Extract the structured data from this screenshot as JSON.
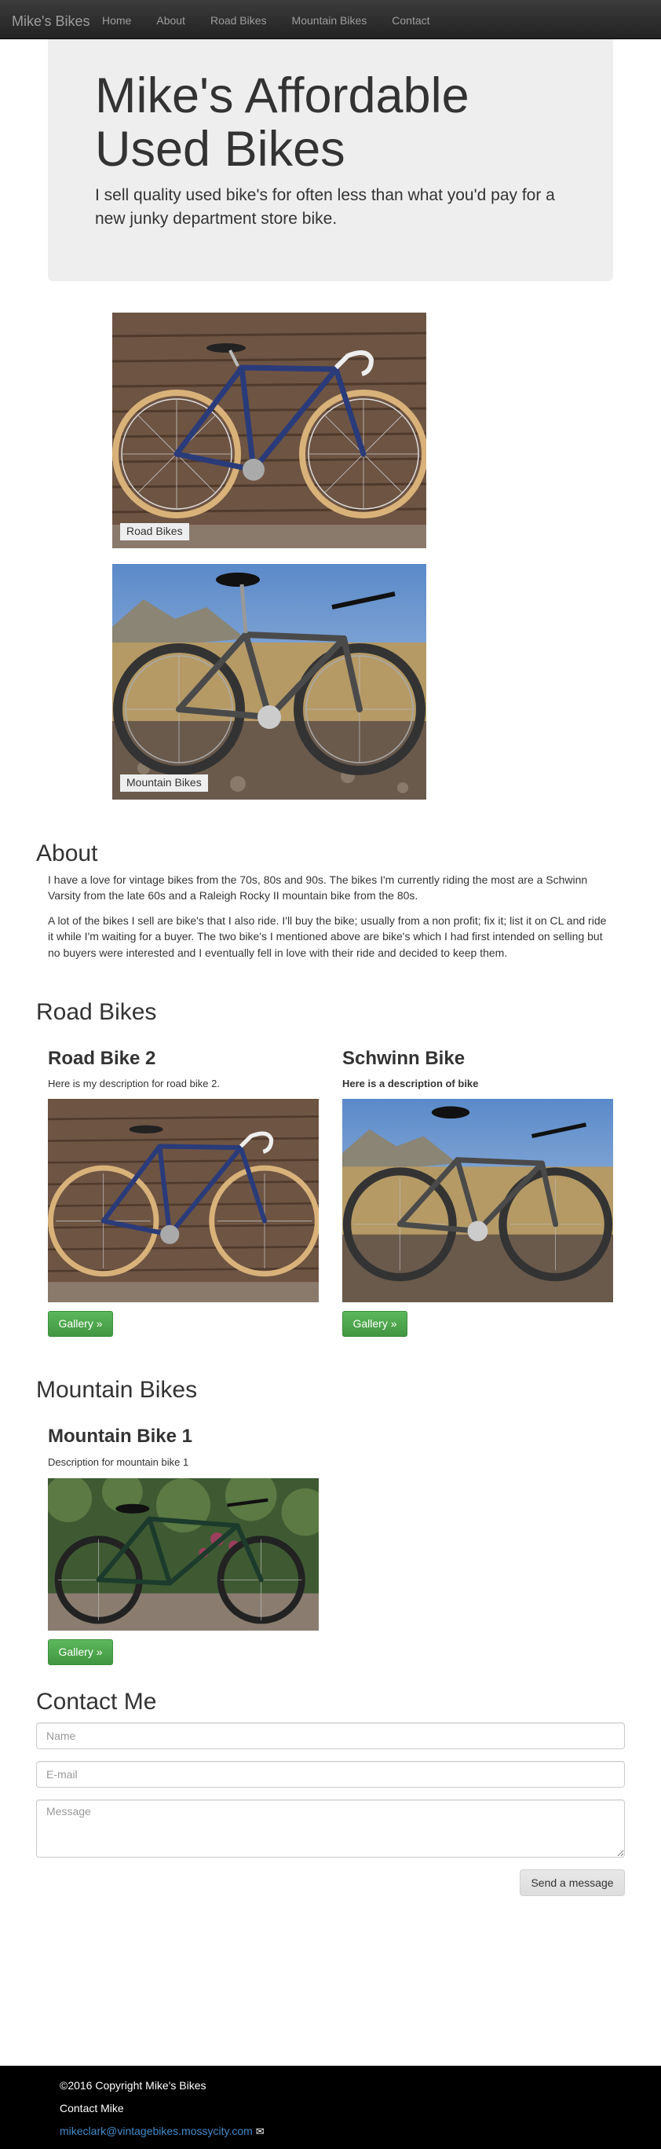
{
  "navbar": {
    "brand": "Mike's Bikes",
    "links": [
      "Home",
      "About",
      "Road Bikes",
      "Mountain Bikes",
      "Contact"
    ]
  },
  "jumbotron": {
    "title": "Mike's Affordable Used Bikes",
    "lead": "I sell quality used bike's for often less than what you'd pay for a new junky department store bike."
  },
  "carousel": {
    "captions": [
      "Road Bikes",
      "Mountain Bikes"
    ]
  },
  "about": {
    "title": "About",
    "paragraphs": [
      "I have a love for vintage bikes from the 70s, 80s and 90s. The bikes I'm currently riding the most are a Schwinn Varsity from the late 60s and a Raleigh Rocky II mountain bike from the 80s.",
      "A lot of the bikes I sell are bike's that I also ride. I'll buy the bike; usually from a non profit; fix it; list it on CL and ride it while I'm waiting for a buyer. The two bike's I mentioned above are bike's which I had first intended on selling but no buyers were interested and I eventually fell in love with their ride and decided to keep them."
    ]
  },
  "road_bikes": {
    "title": "Road Bikes",
    "items": [
      {
        "title": "Road Bike 2",
        "desc": "Here is my description for road bike 2.",
        "button": "Gallery »"
      },
      {
        "title": "Schwinn Bike",
        "desc": "Here is a description of bike",
        "button": "Gallery »"
      }
    ]
  },
  "mountain_bikes": {
    "title": "Mountain Bikes",
    "items": [
      {
        "title": "Mountain Bike 1",
        "desc": "Description for mountain bike  1",
        "button": "Gallery »"
      }
    ]
  },
  "contact": {
    "title": "Contact Me",
    "name_placeholder": "Name",
    "email_placeholder": "E-mail",
    "message_placeholder": "Message",
    "submit": "Send a message"
  },
  "footer": {
    "copyright": "©2016 Copyright Mike's Bikes",
    "contact_label": "Contact Mike",
    "email": "mikeclark@vintagebikes.mossycity.com",
    "mail_icon": "✉"
  },
  "colors": {
    "navbar": "#222222",
    "jumbotron": "#eeeeee",
    "success": "#5cb85c",
    "link": "#428bca"
  }
}
